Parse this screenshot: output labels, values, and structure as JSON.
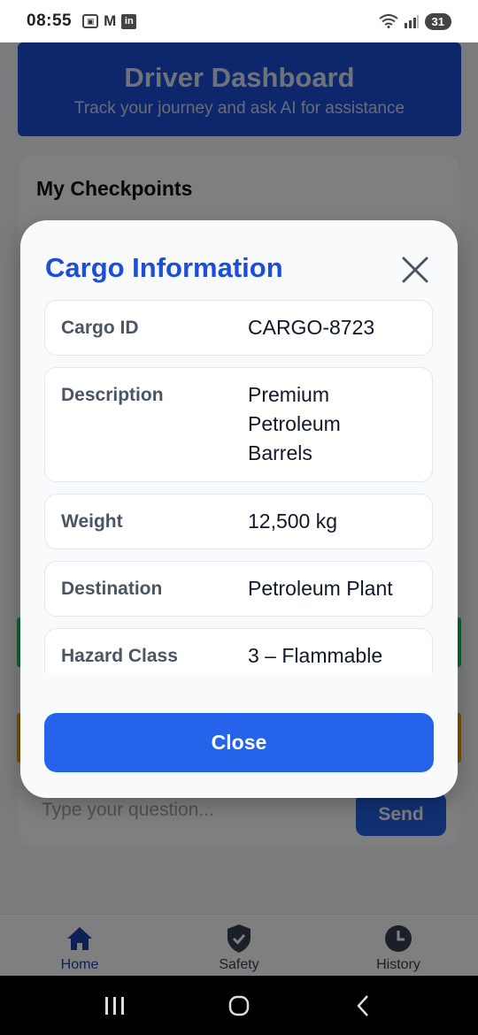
{
  "status_bar": {
    "time": "08:55",
    "left_icons": [
      "screenshot-icon",
      "gmail-icon",
      "linkedin-icon"
    ],
    "right_icons": [
      "wifi-icon",
      "signal-icon"
    ],
    "battery": "31"
  },
  "header": {
    "title": "Driver Dashboard",
    "subtitle": "Track your journey and ask AI for assistance"
  },
  "checkpoints": {
    "title": "My Checkpoints"
  },
  "ask": {
    "placeholder": "Type your question...",
    "send_label": "Send"
  },
  "modal": {
    "title": "Cargo Information",
    "rows": [
      {
        "label": "Cargo ID",
        "value": "CARGO-8723"
      },
      {
        "label": "Description",
        "value": "Premium Petroleum Barrels"
      },
      {
        "label": "Weight",
        "value": "12,500 kg"
      },
      {
        "label": "Destination",
        "value": "Petroleum Plant"
      },
      {
        "label": "Hazard Class",
        "value": "3 – Flammable"
      }
    ],
    "close_label": "Close"
  },
  "bottom_nav": {
    "items": [
      {
        "label": "Home",
        "icon": "home-icon",
        "active": true
      },
      {
        "label": "Safety",
        "icon": "shield-check-icon",
        "active": false
      },
      {
        "label": "History",
        "icon": "clock-icon",
        "active": false
      }
    ]
  },
  "colors": {
    "primary": "#2563eb",
    "header_bg": "#1d4ed8",
    "title_blue": "#1d4ed8",
    "success": "#22c55e",
    "warning": "#f59e0b"
  }
}
